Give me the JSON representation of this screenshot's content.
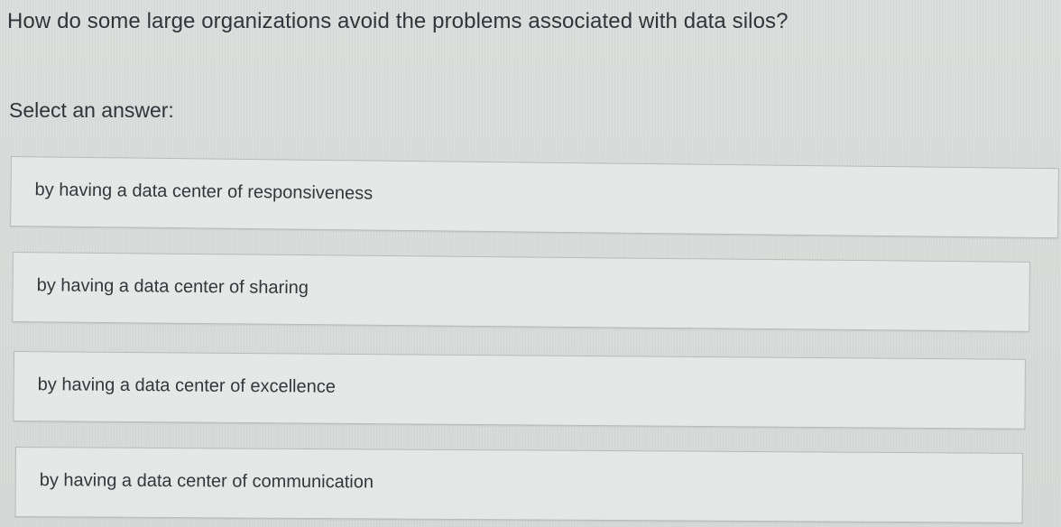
{
  "quiz": {
    "question": "How do some large organizations avoid the problems associated with data silos?",
    "instruction": "Select an answer:",
    "answers": [
      {
        "label": "by having a data center of responsiveness"
      },
      {
        "label": "by having a data center of sharing"
      },
      {
        "label": "by having a data center of excellence"
      },
      {
        "label": "by having a data center of communication"
      }
    ]
  },
  "colors": {
    "background": "#d9dbda",
    "answer_box": "#e8eae9",
    "border": "#b7bab9",
    "text": "#30353a"
  }
}
